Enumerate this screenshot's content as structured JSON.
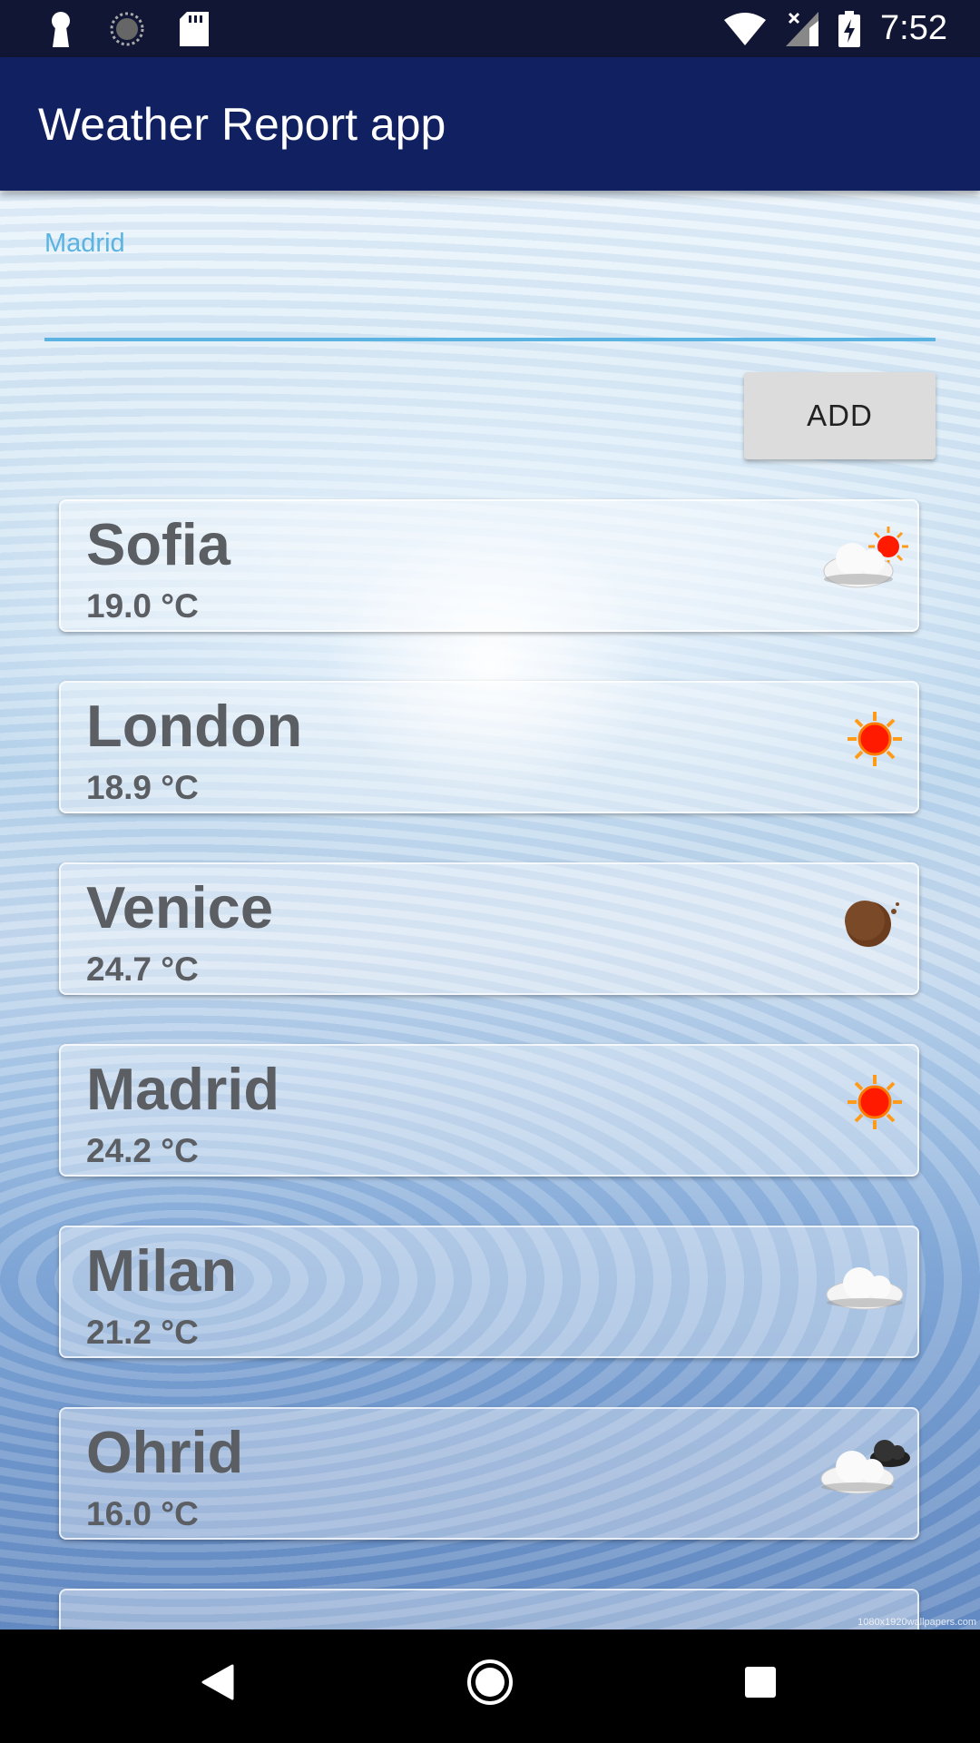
{
  "status_bar": {
    "time": "7:52",
    "left_icons": [
      "keyhole-icon",
      "sync-circle-icon",
      "sd-card-icon"
    ],
    "right_icons": [
      "wifi-icon",
      "no-signal-icon",
      "battery-charging-icon"
    ]
  },
  "app_bar": {
    "title": "Weather Report app"
  },
  "city_field": {
    "label": "Madrid",
    "value": "",
    "accent_color": "#5ab3e0"
  },
  "add_button": {
    "label": "ADD"
  },
  "cities": [
    {
      "name": "Sofia",
      "temperature": "19.0 °C",
      "icon": "cloud-sun-icon"
    },
    {
      "name": "London",
      "temperature": "18.9 °C",
      "icon": "sun-icon"
    },
    {
      "name": "Venice",
      "temperature": "24.7 °C",
      "icon": "moon-icon"
    },
    {
      "name": "Madrid",
      "temperature": "24.2 °C",
      "icon": "sun-icon"
    },
    {
      "name": "Milan",
      "temperature": "21.2 °C",
      "icon": "cloud-icon"
    },
    {
      "name": "Ohrid",
      "temperature": "16.0 °C",
      "icon": "cloud-dark-cloud-icon"
    }
  ],
  "watermark": "1080x1920wallpapers.com",
  "nav_bar": {
    "buttons": [
      "back-icon",
      "home-icon",
      "recents-icon"
    ]
  }
}
